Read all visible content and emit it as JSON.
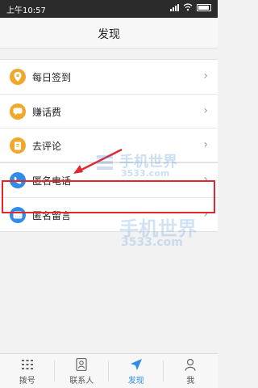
{
  "statusbar": {
    "time": "上午10:57"
  },
  "header": {
    "title": "发现"
  },
  "groups": [
    {
      "items": [
        {
          "label": "每日签到",
          "icon": "location-pin-icon",
          "color": "#f0a72a"
        },
        {
          "label": "赚话费",
          "icon": "chat-icon",
          "color": "#f0a72a"
        },
        {
          "label": "去评论",
          "icon": "comment-icon",
          "color": "#f0a72a"
        }
      ]
    },
    {
      "items": [
        {
          "label": "匿名电话",
          "icon": "phone-icon",
          "color": "#2f8ce8"
        },
        {
          "label": "匿名留言",
          "icon": "message-icon",
          "color": "#2f8ce8"
        }
      ]
    }
  ],
  "tabs": [
    {
      "label": "拨号",
      "icon": "dialpad-icon"
    },
    {
      "label": "联系人",
      "icon": "contacts-icon"
    },
    {
      "label": "发现",
      "icon": "discover-icon",
      "active": true
    },
    {
      "label": "我",
      "icon": "user-icon"
    }
  ],
  "watermark": {
    "text": "手机世界",
    "sub": "3533.com"
  }
}
